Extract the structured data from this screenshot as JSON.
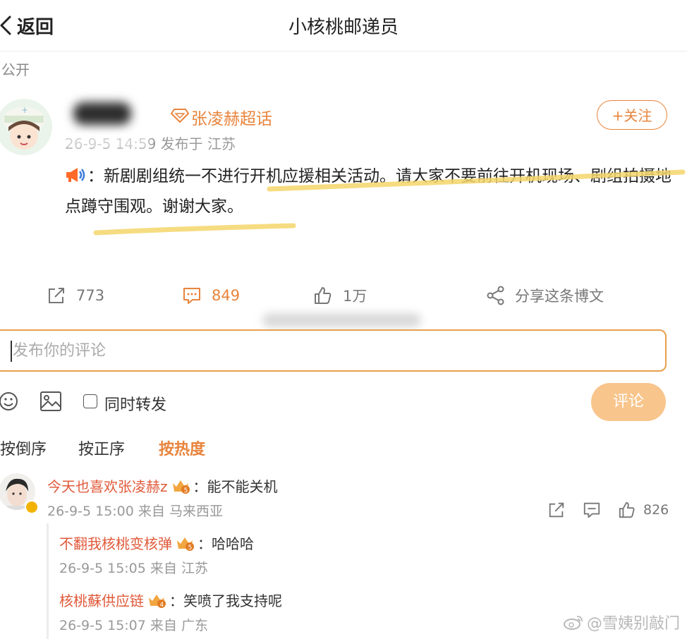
{
  "header": {
    "back_label": "返回",
    "title": "小核桃邮递员"
  },
  "visibility": "公开",
  "post": {
    "topic": "张凌赫超话",
    "meta": "26-9-5 14:59 发布于 江苏",
    "follow_label": "+关注",
    "content": "：新剧剧组统一不进行开机应援相关活动。请大家不要前往开机现场、剧组拍摄地点蹲守围观。谢谢大家。",
    "actions": {
      "repost": "773",
      "comment": "849",
      "like": "1万",
      "share": "分享这条博文"
    }
  },
  "composer": {
    "placeholder": "发布你的评论",
    "repost_label": "同时转发",
    "submit_label": "评论"
  },
  "sort": {
    "newest": "按倒序",
    "oldest": "按正序",
    "hot": "按热度"
  },
  "comments": [
    {
      "name": "今天也喜欢张凌赫z",
      "text": "：能不能关机",
      "meta": "26-9-5 15:00 来自 马来西亚",
      "likes": "826",
      "replies": [
        {
          "name": "不翻我核桃变核弹",
          "text": "：哈哈哈",
          "meta": "26-9-5 15:05 来自 江苏"
        },
        {
          "name": "核桃蘇供应链",
          "text": "：笑喷了我支持呢",
          "meta": "26-9-5 15:07 来自 广东"
        }
      ]
    }
  ],
  "watermark": "@雪姨别敲门",
  "colors": {
    "accent": "#e8843c",
    "highlight": "#f5d66b",
    "submit": "#f8c58c",
    "name": "#e05a3a"
  }
}
